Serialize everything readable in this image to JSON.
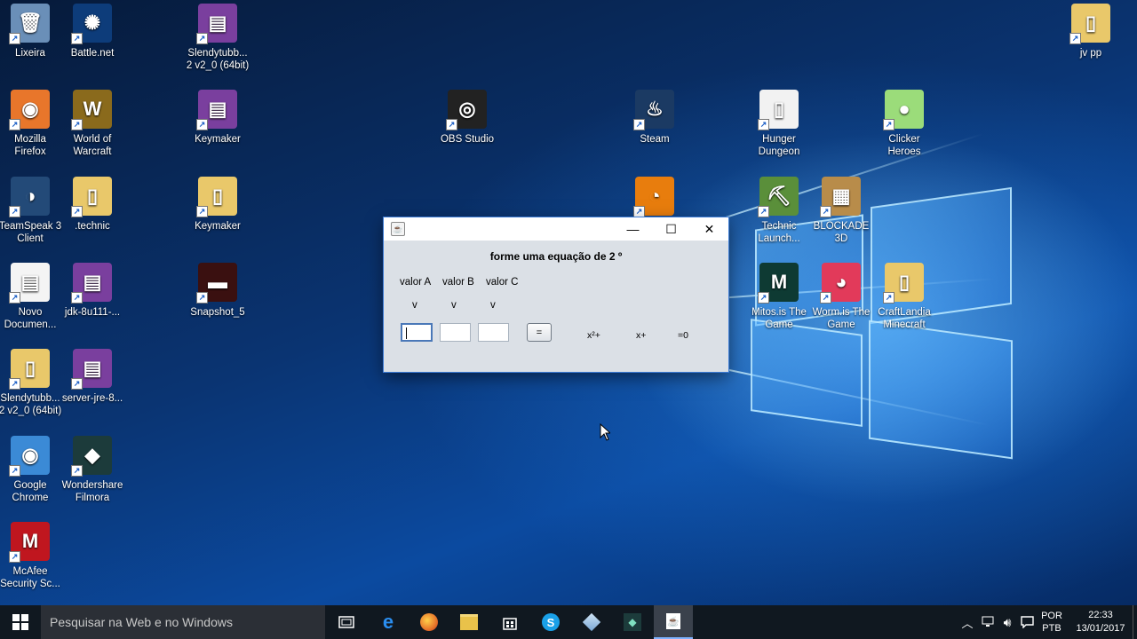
{
  "desktop_icons": [
    {
      "name": "desktop-icon-lixeira",
      "label": "Lixeira",
      "glyph": "🗑",
      "bg": "#6a8fb8"
    },
    {
      "name": "desktop-icon-battlenet",
      "label": "Battle.net",
      "glyph": "✺",
      "bg": "#0d3c7a"
    },
    {
      "name": "desktop-icon-slendytubbies",
      "label": "Slendytubb...\n2 v2_0 (64bit)",
      "glyph": "▤",
      "bg": "#7a3f9e"
    },
    {
      "name": "desktop-icon-jv-pp",
      "label": "jv pp",
      "glyph": "▯",
      "bg": "#e9c86a"
    },
    {
      "name": "desktop-icon-firefox",
      "label": "Mozilla\nFirefox",
      "glyph": "◉",
      "bg": "#e8762b"
    },
    {
      "name": "desktop-icon-world-of-warcraft",
      "label": "World of\nWarcraft",
      "glyph": "W",
      "bg": "#8a6a1c"
    },
    {
      "name": "desktop-icon-keymaker",
      "label": "Keymaker",
      "glyph": "▤",
      "bg": "#7a3f9e"
    },
    {
      "name": "desktop-icon-obs",
      "label": "OBS Studio",
      "glyph": "◎",
      "bg": "#222"
    },
    {
      "name": "desktop-icon-steam",
      "label": "Steam",
      "glyph": "♨",
      "bg": "#1b3a63"
    },
    {
      "name": "desktop-icon-hunger-dungeon",
      "label": "Hunger\nDungeon",
      "glyph": "▯",
      "bg": "#f2f2f2"
    },
    {
      "name": "desktop-icon-clicker-heroes",
      "label": "Clicker\nHeroes",
      "glyph": "●",
      "bg": "#9bdc7a"
    },
    {
      "name": "desktop-icon-teamspeak",
      "label": "TeamSpeak 3\nClient",
      "glyph": "◑",
      "bg": "#234a78"
    },
    {
      "name": "desktop-icon-technic-folder",
      "label": ".technic",
      "glyph": "▯",
      "bg": "#e9c86a"
    },
    {
      "name": "desktop-icon-keymaker-folder",
      "label": "Keymaker",
      "glyph": "▯",
      "bg": "#e9c86a"
    },
    {
      "name": "desktop-icon-blender",
      "label": "",
      "glyph": "◔",
      "bg": "#e87d0d"
    },
    {
      "name": "desktop-icon-technic-launcher",
      "label": "Technic\nLaunch...",
      "glyph": "⛏",
      "bg": "#5a8f3a"
    },
    {
      "name": "desktop-icon-blockade",
      "label": "BLOCKADE\n3D",
      "glyph": "▦",
      "bg": "#b88c4a"
    },
    {
      "name": "desktop-icon-novo-documento",
      "label": "Novo\nDocumen...",
      "glyph": "▤",
      "bg": "#f4f4f4"
    },
    {
      "name": "desktop-icon-jdk",
      "label": "jdk-8u111-...",
      "glyph": "▤",
      "bg": "#7a3f9e"
    },
    {
      "name": "desktop-icon-snapshot",
      "label": "Snapshot_5",
      "glyph": "▬",
      "bg": "#3a1010"
    },
    {
      "name": "desktop-icon-mitosis",
      "label": "Mitos.is The\nGame",
      "glyph": "M",
      "bg": "#0e3a33"
    },
    {
      "name": "desktop-icon-wormis",
      "label": "Worm.is The\nGame",
      "glyph": "◕",
      "bg": "#e23a5a"
    },
    {
      "name": "desktop-icon-craftlandia",
      "label": "CraftLandia\nMinecraft",
      "glyph": "▯",
      "bg": "#e9c86a"
    },
    {
      "name": "desktop-icon-slendytubbies-2",
      "label": "Slendytubb...\n2 v2_0 (64bit)",
      "glyph": "▯",
      "bg": "#e9c86a"
    },
    {
      "name": "desktop-icon-server-jre",
      "label": "server-jre-8...",
      "glyph": "▤",
      "bg": "#7a3f9e"
    },
    {
      "name": "desktop-icon-chrome",
      "label": "Google\nChrome",
      "glyph": "◉",
      "bg": "#3b8ad6"
    },
    {
      "name": "desktop-icon-filmora",
      "label": "Wondershare\nFilmora",
      "glyph": "◆",
      "bg": "#1c3b3b"
    },
    {
      "name": "desktop-icon-mcafee",
      "label": "McAfee\nSecurity Sc...",
      "glyph": "M",
      "bg": "#c0161f"
    }
  ],
  "window": {
    "title_icon": "java-icon",
    "heading": "forme uma equação de 2 º",
    "label_a": "valor A",
    "label_b": "valor B",
    "label_c": "valor C",
    "v_a": "v",
    "v_b": "v",
    "v_c": "v",
    "equals_button": "=",
    "result_x2": "x²+",
    "result_x": "x+",
    "result_eq": "=0",
    "minimize": "—",
    "maximize": "☐",
    "close": "✕"
  },
  "taskbar": {
    "search_placeholder": "Pesquisar na Web e no Windows",
    "language_top": "POR",
    "language_bottom": "PTB",
    "time": "22:33",
    "date": "13/01/2017"
  },
  "colors": {
    "window_bg": "#dbe0e6",
    "taskbar_bg": "#101820",
    "accent": "#3c7bd5"
  }
}
